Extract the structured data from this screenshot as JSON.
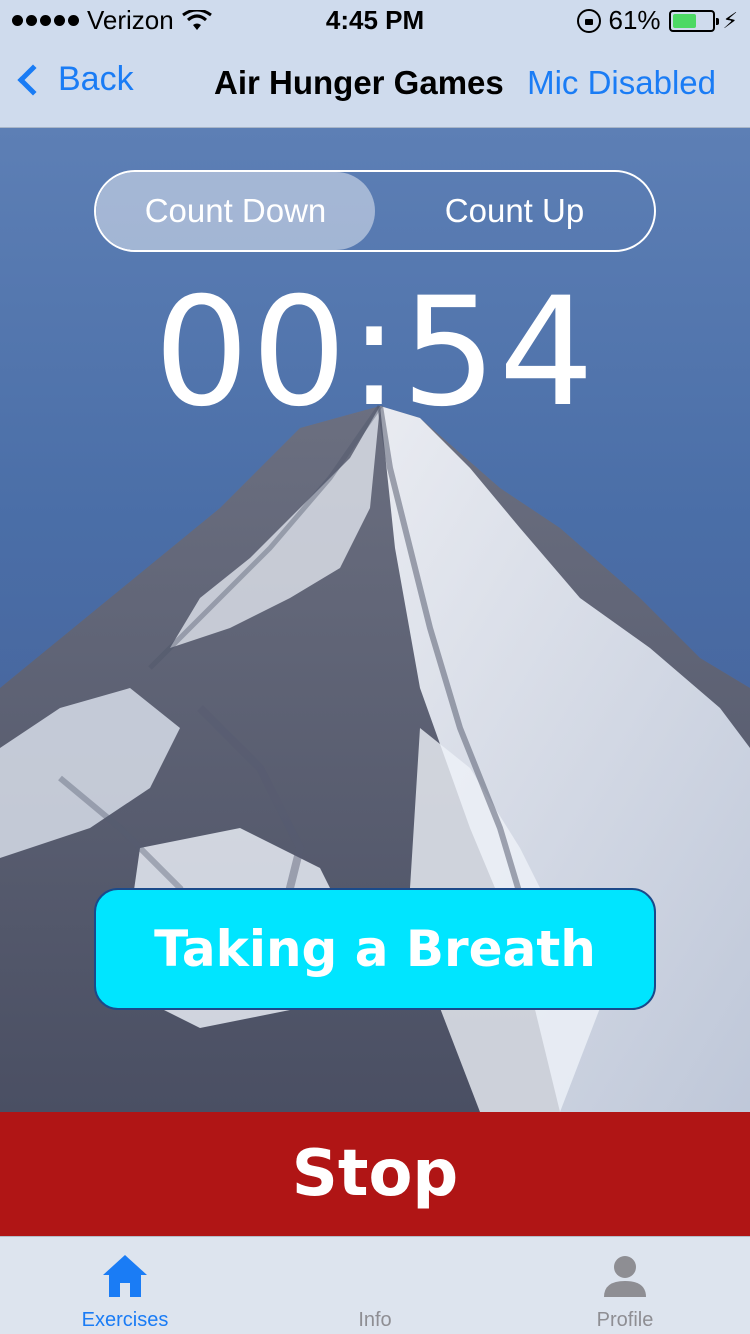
{
  "status_bar": {
    "carrier": "Verizon",
    "time": "4:45 PM",
    "battery": "61%",
    "battery_level": 0.61
  },
  "nav": {
    "back_label": "Back",
    "title": "Air Hunger Games",
    "mic_label": "Mic Disabled"
  },
  "timer_mode": {
    "options": [
      "Count Down",
      "Count Up"
    ],
    "selected": "Count Down"
  },
  "timer": {
    "minutes": "00",
    "separator": ":",
    "seconds": "54"
  },
  "breath_button": {
    "label": "Taking a Breath",
    "color": "#00e5ff"
  },
  "stop_button": {
    "label": "Stop",
    "color": "#b01515"
  },
  "tabs": [
    {
      "label": "Exercises",
      "icon": "home-icon",
      "active": true
    },
    {
      "label": "Info",
      "icon": "info-icon",
      "active": false
    },
    {
      "label": "Profile",
      "icon": "person-icon",
      "active": false
    }
  ],
  "colors": {
    "accent": "#1a7cf5",
    "bar_background": "#cfdbed"
  }
}
